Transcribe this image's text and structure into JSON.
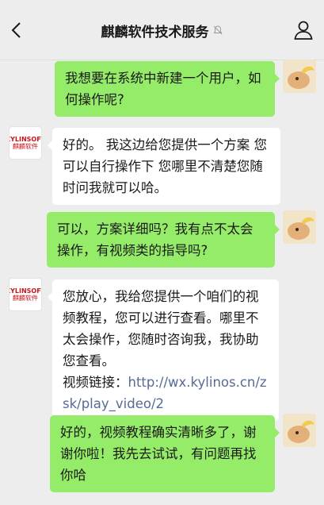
{
  "header": {
    "title": "麒麟软件技术服务",
    "back_icon": "chevron-left-icon",
    "mute_icon": "bell-off-icon",
    "profile_icon": "person-icon"
  },
  "service_logo": {
    "line1": "KYLINSOFT",
    "line2": "麒麟软件"
  },
  "messages": [
    {
      "sender": "me",
      "text": "我想要在系统中新建一个用户，如何操作呢?"
    },
    {
      "sender": "service",
      "text": "好的。 我这边给您提供一个方案 您可以自行操作下 您哪里不清楚您随时问我就可以哈。"
    },
    {
      "sender": "me",
      "text": "可以，方案详细吗？我有点不太会操作，有视频类的指导吗?"
    },
    {
      "sender": "service",
      "text": "您放心，我给您提供一个咱们的视频教程，您可以进行查看。哪里不太会操作，您随时咨询我，我协助您查看。",
      "link_prefix": "视频链接：",
      "link": "http://wx.kylinos.cn/zsk/play_video/2"
    },
    {
      "sender": "me",
      "text": "好的，视频教程确实清晰多了，谢谢你啦！我先去试试，有问题再找你哈"
    }
  ],
  "colors": {
    "background": "#ededed",
    "my_bubble": "#95ec69",
    "service_bubble": "#ffffff",
    "link": "#576b95",
    "logo_red": "#c8161d"
  }
}
